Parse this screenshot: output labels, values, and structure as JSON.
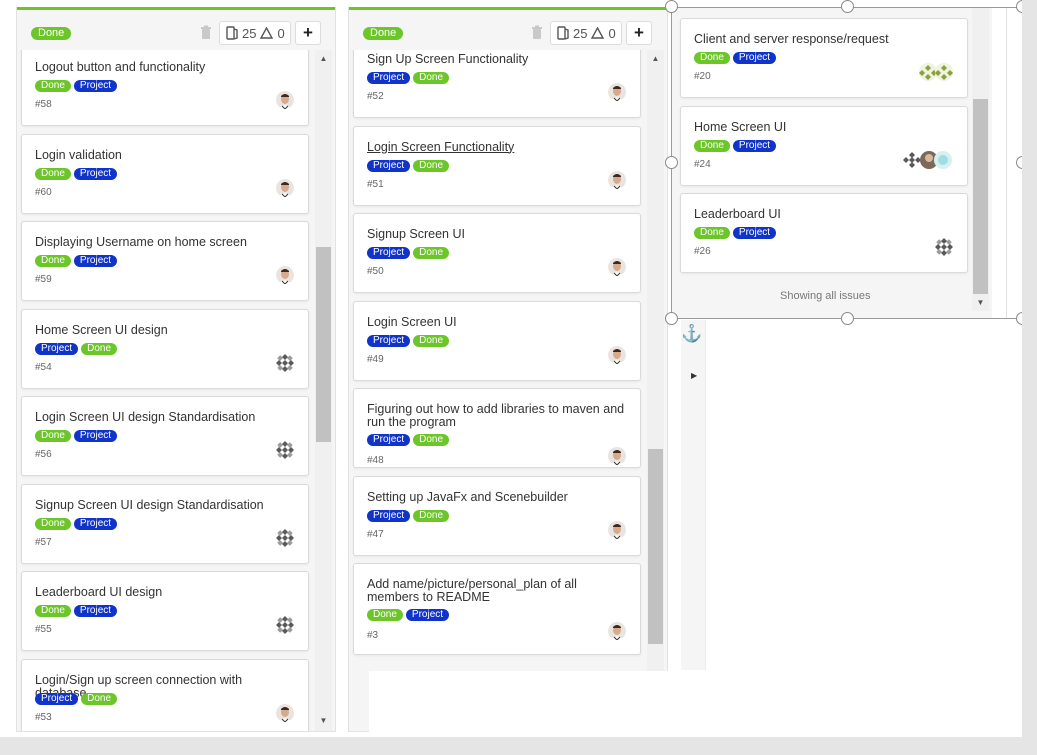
{
  "columns": [
    {
      "status": "Done",
      "issue_count": "25",
      "warn_count": "0",
      "add_label": "+",
      "cards": [
        {
          "title": "Logout button and functionality",
          "labels": [
            "Done",
            "Project"
          ],
          "number": "#58",
          "avatar": "person"
        },
        {
          "title": "Login validation",
          "labels": [
            "Done",
            "Project"
          ],
          "number": "#60",
          "avatar": "person"
        },
        {
          "title": "Displaying Username on home screen",
          "labels": [
            "Done",
            "Project"
          ],
          "number": "#59",
          "avatar": "person"
        },
        {
          "title": "Home Screen UI design",
          "labels": [
            "Project",
            "Done"
          ],
          "number": "#54",
          "avatar": "pattern"
        },
        {
          "title": "Login Screen UI design Standardisation",
          "labels": [
            "Done",
            "Project"
          ],
          "number": "#56",
          "avatar": "pattern"
        },
        {
          "title": "Signup Screen UI design Standardisation",
          "labels": [
            "Done",
            "Project"
          ],
          "number": "#57",
          "avatar": "pattern"
        },
        {
          "title": "Leaderboard UI design",
          "labels": [
            "Done",
            "Project"
          ],
          "number": "#55",
          "avatar": "pattern"
        },
        {
          "title": "Login/Sign up screen connection with database",
          "labels": [
            "Project",
            "Done"
          ],
          "number": "#53",
          "avatar": "person"
        }
      ]
    },
    {
      "status": "Done",
      "issue_count": "25",
      "warn_count": "0",
      "add_label": "+",
      "cards": [
        {
          "title": "Sign Up Screen Functionality",
          "labels": [
            "Project",
            "Done"
          ],
          "number": "#52",
          "avatar": "person"
        },
        {
          "title": "Login Screen Functionality",
          "labels": [
            "Project",
            "Done"
          ],
          "number": "#51",
          "avatar": "person"
        },
        {
          "title": "Signup Screen UI",
          "labels": [
            "Project",
            "Done"
          ],
          "number": "#50",
          "avatar": "person"
        },
        {
          "title": "Login Screen UI",
          "labels": [
            "Project",
            "Done"
          ],
          "number": "#49",
          "avatar": "person"
        },
        {
          "title": "Figuring out how to add libraries to maven and run the program",
          "labels": [
            "Project",
            "Done"
          ],
          "number": "#48",
          "avatar": "person"
        },
        {
          "title": "Setting up JavaFx and Scenebuilder",
          "labels": [
            "Project",
            "Done"
          ],
          "number": "#47",
          "avatar": "person"
        },
        {
          "title": "Add name/picture/personal_plan of all members to README",
          "labels": [
            "Done",
            "Project"
          ],
          "number": "#3",
          "avatar": "person"
        }
      ]
    },
    {
      "cards": [
        {
          "title": "Client and server response/request",
          "labels": [
            "Done",
            "Project"
          ],
          "number": "#20",
          "avatar": "green-pattern"
        },
        {
          "title": "Home Screen UI",
          "labels": [
            "Done",
            "Project"
          ],
          "number": "#24",
          "avatar": "group"
        },
        {
          "title": "Leaderboard UI",
          "labels": [
            "Done",
            "Project"
          ],
          "number": "#26",
          "avatar": "pattern"
        }
      ],
      "footer": "Showing all issues"
    }
  ],
  "colors": {
    "done": "#6cc62a",
    "project": "#1033c9",
    "accent_bar": "#6cc62a",
    "anchor": "#3d7ab8"
  },
  "icons": {
    "trash": "trash-icon",
    "issues": "issues-icon",
    "warning": "warning-icon",
    "add": "plus-icon",
    "anchor": "anchor-icon",
    "expand": "expand-arrow-icon"
  }
}
